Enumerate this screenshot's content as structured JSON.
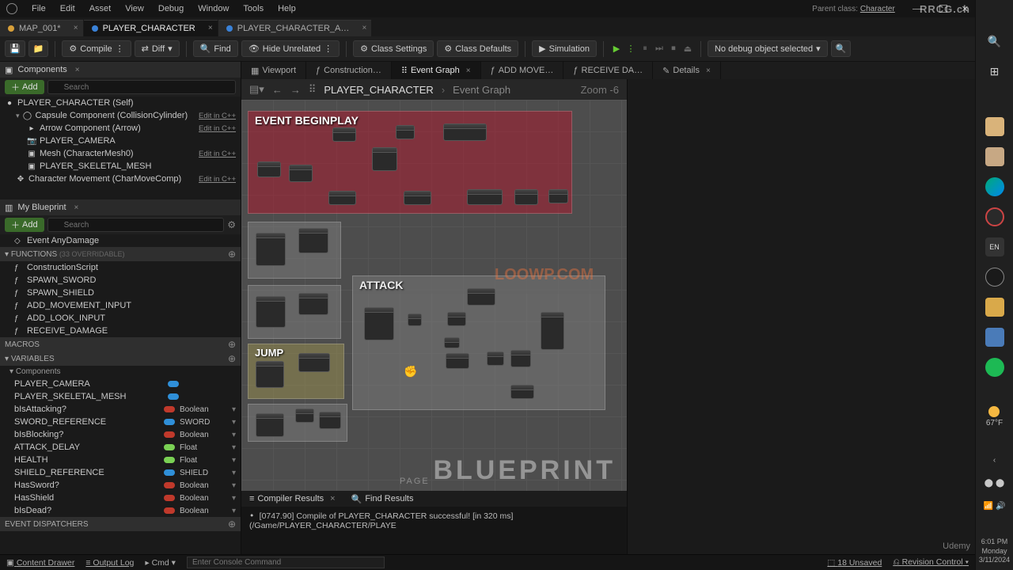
{
  "watermarks": {
    "top_right": "RRCG.ch",
    "center": "LOOWP.COM",
    "bottom_right": "Udemy"
  },
  "menubar": {
    "items": [
      "File",
      "Edit",
      "Asset",
      "View",
      "Debug",
      "Window",
      "Tools",
      "Help"
    ],
    "parent_label": "Parent class:",
    "parent_class": "Character"
  },
  "filetabs": [
    {
      "label": "MAP_001*",
      "active": false,
      "color": "#d8a03a"
    },
    {
      "label": "PLAYER_CHARACTER",
      "active": true,
      "color": "#3a82d8"
    },
    {
      "label": "PLAYER_CHARACTER_A…",
      "active": false,
      "color": "#3a82d8"
    }
  ],
  "toolbar": {
    "save": "",
    "browse": "",
    "compile": "Compile",
    "diff": "Diff",
    "find": "Find",
    "hide_unrelated": "Hide Unrelated",
    "class_settings": "Class Settings",
    "class_defaults": "Class Defaults",
    "simulation": "Simulation",
    "debug_selector": "No debug object selected"
  },
  "components": {
    "panel_title": "Components",
    "add": "Add",
    "search_placeholder": "Search",
    "rows": [
      {
        "label": "PLAYER_CHARACTER (Self)",
        "indent": 0,
        "icon": "●",
        "edit": ""
      },
      {
        "label": "Capsule Component (CollisionCylinder)",
        "indent": 1,
        "icon": "◯",
        "edit": "Edit in C++"
      },
      {
        "label": "Arrow Component (Arrow)",
        "indent": 2,
        "icon": "▸",
        "edit": "Edit in C++"
      },
      {
        "label": "PLAYER_CAMERA",
        "indent": 2,
        "icon": "📷",
        "edit": ""
      },
      {
        "label": "Mesh (CharacterMesh0)",
        "indent": 2,
        "icon": "▣",
        "edit": "Edit in C++"
      },
      {
        "label": "PLAYER_SKELETAL_MESH",
        "indent": 2,
        "icon": "▣",
        "edit": ""
      },
      {
        "label": "Character Movement (CharMoveComp)",
        "indent": 1,
        "icon": "✥",
        "edit": "Edit in C++"
      }
    ]
  },
  "myblueprint": {
    "panel_title": "My Blueprint",
    "add": "Add",
    "search_placeholder": "Search",
    "override": "Event AnyDamage",
    "sections": {
      "functions": {
        "label": "FUNCTIONS",
        "badge": "(33 OVERRIDABLE)"
      },
      "macros": "MACROS",
      "variables": "VARIABLES",
      "components_sub": "Components",
      "dispatchers": "EVENT DISPATCHERS"
    },
    "functions": [
      "ConstructionScript",
      "SPAWN_SWORD",
      "SPAWN_SHIELD",
      "ADD_MOVEMENT_INPUT",
      "ADD_LOOK_INPUT",
      "RECEIVE_DAMAGE"
    ],
    "component_vars": [
      "PLAYER_CAMERA",
      "PLAYER_SKELETAL_MESH"
    ],
    "variables_list": [
      {
        "name": "bIsAttacking?",
        "type": "Boolean",
        "color": "#c0392b"
      },
      {
        "name": "SWORD_REFERENCE",
        "type": "SWORD",
        "color": "#2f8fd8"
      },
      {
        "name": "bIsBlocking?",
        "type": "Boolean",
        "color": "#c0392b"
      },
      {
        "name": "ATTACK_DELAY",
        "type": "Float",
        "color": "#7ad154"
      },
      {
        "name": "HEALTH",
        "type": "Float",
        "color": "#7ad154"
      },
      {
        "name": "SHIELD_REFERENCE",
        "type": "SHIELD",
        "color": "#2f8fd8"
      },
      {
        "name": "HasSword?",
        "type": "Boolean",
        "color": "#c0392b"
      },
      {
        "name": "HasShield",
        "type": "Boolean",
        "color": "#c0392b"
      },
      {
        "name": "bIsDead?",
        "type": "Boolean",
        "color": "#c0392b"
      }
    ]
  },
  "center": {
    "tabs": [
      {
        "label": "Viewport",
        "icon": "▦",
        "active": false
      },
      {
        "label": "Construction…",
        "icon": "ƒ",
        "active": false
      },
      {
        "label": "Event Graph",
        "icon": "⠿",
        "active": true,
        "closable": true
      },
      {
        "label": "ADD MOVE…",
        "icon": "ƒ",
        "active": false
      },
      {
        "label": "RECEIVE DA…",
        "icon": "ƒ",
        "active": false
      },
      {
        "label": "Details",
        "icon": "✎",
        "active": false,
        "closable": true
      }
    ],
    "breadcrumb": {
      "root": "PLAYER_CHARACTER",
      "current": "Event Graph",
      "zoom": "Zoom  -6"
    },
    "comments": {
      "beginplay": "EVENT BEGINPLAY",
      "attack": "ATTACK",
      "jump": "JUMP"
    },
    "watermark": "BLUEPRINT",
    "page_wm": "PAGE"
  },
  "compiler": {
    "tab1": "Compiler Results",
    "tab2": "Find Results",
    "log": "[0747.90] Compile of PLAYER_CHARACTER successful! [in 320 ms] (/Game/PLAYER_CHARACTER/PLAYE"
  },
  "bottombar": {
    "content_drawer": "Content Drawer",
    "output_log": "Output Log",
    "cmd_label": "Cmd",
    "cmd_placeholder": "Enter Console Command",
    "unsaved": "18 Unsaved",
    "revision": "Revision Control"
  },
  "tray": {
    "weather_temp": "67°F",
    "clock_time": "6:01 PM",
    "clock_day": "Monday",
    "clock_date": "3/11/2024"
  }
}
